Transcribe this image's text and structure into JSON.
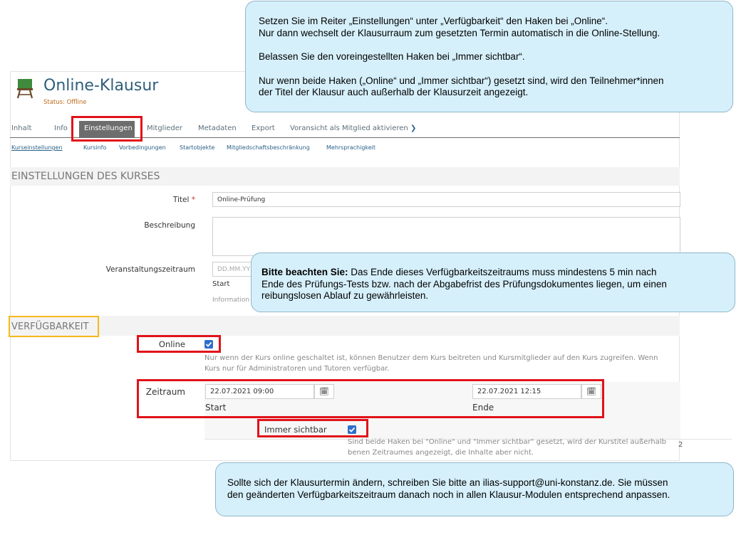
{
  "header": {
    "title": "Online-Klausur",
    "status": "Status: Offline"
  },
  "tabs": [
    {
      "label": "Inhalt"
    },
    {
      "label": "Info"
    },
    {
      "label": "Einstellungen"
    },
    {
      "label": "Mitglieder"
    },
    {
      "label": "Metadaten"
    },
    {
      "label": "Export"
    },
    {
      "label": "Voransicht als Mitglied aktivieren"
    }
  ],
  "subtabs": [
    {
      "label": "Kurseinstellungen"
    },
    {
      "label": "Kursinfo"
    },
    {
      "label": "Vorbedingungen"
    },
    {
      "label": "Startobjekte"
    },
    {
      "label": "Mitgliedschaftsbeschränkung"
    },
    {
      "label": "Mehrsprachigkeit"
    }
  ],
  "section_settings": {
    "heading": "EINSTELLUNGEN DES KURSES",
    "title_label": "Titel",
    "required_mark": "*",
    "title_value": "Online-Prüfung",
    "description_label": "Beschreibung",
    "period_label": "Veranstaltungszeitraum",
    "period_placeholder": "DD.MM.YY",
    "period_start_label": "Start",
    "period_info": "Information"
  },
  "section_availability": {
    "heading": "VERFÜGBARKEIT",
    "online_label": "Online",
    "online_info_line1": "Nur wenn der Kurs online geschaltet ist, können Benutzer dem Kurs beitreten und Kursmitglieder auf den Kurs zugreifen. Wenn",
    "online_info_line2": "Kurs nur für Administratoren und Tutoren verfügbar.",
    "period_label": "Zeitraum",
    "start_value": "22.07.2021 09:00",
    "start_label": "Start",
    "end_value": "22.07.2021 12:15",
    "end_label": "Ende",
    "always_visible_label": "Immer sichtbar",
    "visible_info_line1": "Sind beide Haken bei \"Online\" und \"Immer sichtbar\" gesetzt, wird der Kurstitel außerhalb",
    "visible_info_line2": "benen Zeitraumes angezeigt, die Inhalte aber nicht.",
    "cut_text": "2"
  },
  "callouts": {
    "top": {
      "line1": "Setzen Sie im Reiter „Einstellungen“ unter „Verfügbarkeit“ den Haken bei „Online“.",
      "line2": "Nur dann wechselt der Klausurraum zum gesetzten Termin automatisch in die Online-Stellung.",
      "line3": "Belassen Sie den voreingestellten Haken bei „Immer sichtbar“.",
      "line4": "Nur wenn beide Haken („Online“ und „Immer sichtbar“) gesetzt sind, wird den Teilnehmer*innen",
      "line5": "der Titel der Klausur auch außerhalb der Klausurzeit angezeigt."
    },
    "middle": {
      "bold": "Bitte beachten Sie:",
      "line1": " Das Ende dieses Verfügbarkeitszeitraums muss mindestens 5 min nach",
      "line2": "Ende des Prüfungs-Tests bzw. nach der Abgabefrist des Prüfungsdokumentes liegen, um einen",
      "line3": "reibungslosen Ablauf zu gewährleisten."
    },
    "bottom": {
      "line1": "Sollte sich der Klausurtermin ändern, schreiben Sie bitte an ilias-support@uni-konstanz.de. Sie müssen",
      "line2": "den geänderten Verfügbarkeitszeitraum danach noch in allen Klausur-Modulen entsprechend anpassen."
    }
  },
  "colors": {
    "highlight_red": "#e1121a",
    "highlight_yellow": "#f6b81b",
    "callout_bg": "#d6f0fb",
    "checkbox_blue": "#2f6fcb",
    "status_orange": "#c06a1e"
  }
}
